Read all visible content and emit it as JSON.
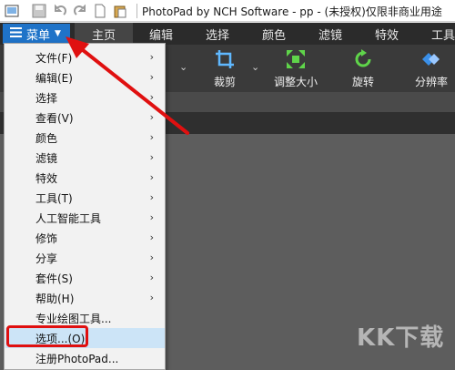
{
  "app": {
    "title": "PhotoPad by NCH Software - pp - (未授权)仅限非商业用途"
  },
  "quick_access": [
    {
      "name": "app-icon"
    },
    {
      "name": "save-icon"
    },
    {
      "name": "undo-icon"
    },
    {
      "name": "redo-icon"
    },
    {
      "name": "new-icon"
    },
    {
      "name": "paste-icon"
    }
  ],
  "menu_button": {
    "label": "菜单"
  },
  "tabs": [
    {
      "label": "主页",
      "active": true
    },
    {
      "label": "编辑"
    },
    {
      "label": "选择"
    },
    {
      "label": "颜色"
    },
    {
      "label": "滤镜"
    },
    {
      "label": "特效"
    },
    {
      "label": "工具"
    }
  ],
  "toolbar": {
    "crop_label": "裁剪",
    "resize_label": "调整大小",
    "rotate_label": "旋转",
    "resolution_label": "分辨率"
  },
  "dropdown_menu": {
    "items": [
      {
        "label": "文件(F)",
        "submenu": true
      },
      {
        "label": "编辑(E)",
        "submenu": true
      },
      {
        "label": "选择",
        "submenu": true
      },
      {
        "label": "查看(V)",
        "submenu": true
      },
      {
        "label": "颜色",
        "submenu": true
      },
      {
        "label": "滤镜",
        "submenu": true
      },
      {
        "label": "特效",
        "submenu": true
      },
      {
        "label": "工具(T)",
        "submenu": true
      },
      {
        "label": "人工智能工具",
        "submenu": true
      },
      {
        "label": "修饰",
        "submenu": true
      },
      {
        "label": "分享",
        "submenu": true
      },
      {
        "label": "套件(S)",
        "submenu": true
      },
      {
        "label": "帮助(H)",
        "submenu": true
      },
      {
        "label": "专业绘图工具...",
        "submenu": false
      },
      {
        "label": "选项...(O)",
        "submenu": false,
        "highlighted": true
      },
      {
        "label": "注册PhotoPad...",
        "submenu": false
      }
    ]
  },
  "watermark": "KK下载",
  "colors": {
    "accent": "#1f73c8",
    "annotation_red": "#e01010",
    "highlight": "#cce4f7"
  }
}
